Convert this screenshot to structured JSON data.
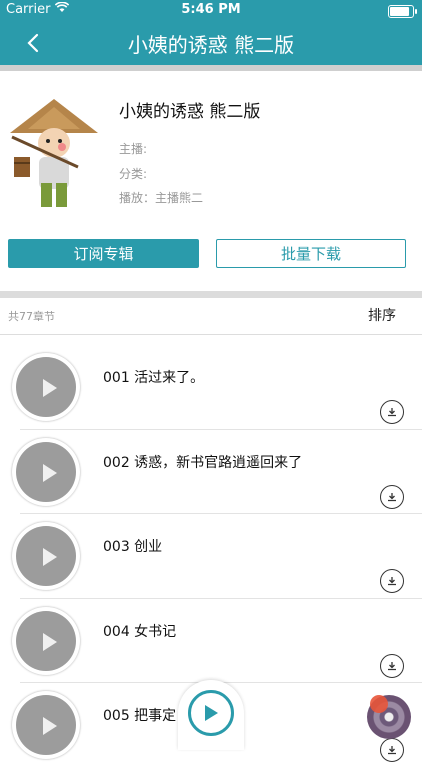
{
  "status": {
    "carrier": "Carrier",
    "time": "5:46 PM",
    "battery_level": 0.95
  },
  "nav": {
    "title": "小姨的诱惑 熊二版",
    "back_icon": "chevron-left-icon"
  },
  "album": {
    "title": "小姨的诱惑 熊二版",
    "host_label": "主播:",
    "category_label": "分类:",
    "plays_label": "播放：主播熊二",
    "subscribe_label": "订阅专辑",
    "batch_download_label": "批量下载"
  },
  "list_header": {
    "count_label": "共77章节",
    "sort_label": "排序"
  },
  "chapters": [
    {
      "title": "001 活过来了。"
    },
    {
      "title": "002 诱惑，新书官路逍遥回来了"
    },
    {
      "title": "003 创业"
    },
    {
      "title": "004 女书记"
    },
    {
      "title": "005 把事定"
    }
  ],
  "colors": {
    "accent": "#2a9bab",
    "divider": "#dcdcdc"
  }
}
